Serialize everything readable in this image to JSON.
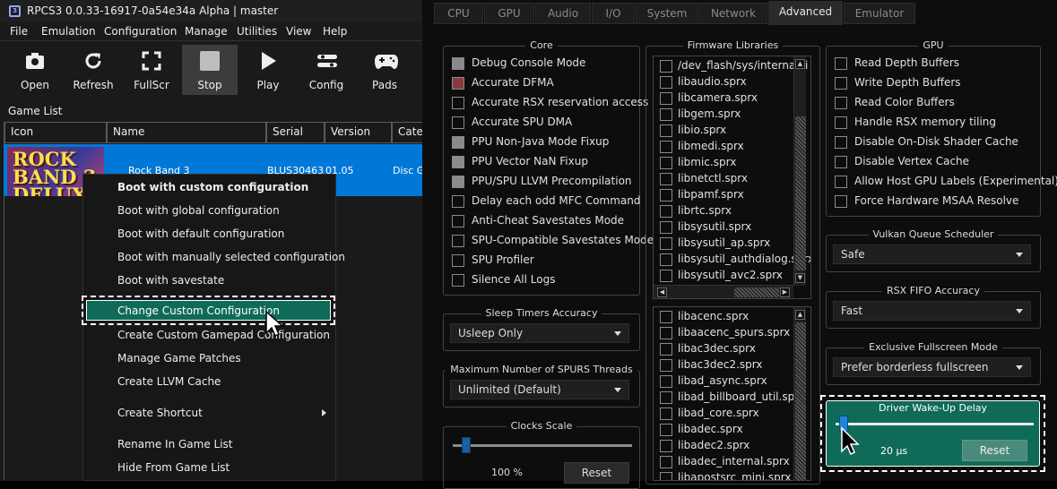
{
  "window": {
    "title": "RPCS3 0.0.33-16917-0a54e34a Alpha | master"
  },
  "menu": [
    "File",
    "Emulation",
    "Configuration",
    "Manage",
    "Utilities",
    "View",
    "Help"
  ],
  "toolbar": [
    {
      "label": "Open",
      "icon": "open-icon"
    },
    {
      "label": "Refresh",
      "icon": "refresh-icon"
    },
    {
      "label": "FullScr",
      "icon": "fullscreen-icon"
    },
    {
      "label": "Stop",
      "icon": "stop-icon",
      "active": true
    },
    {
      "label": "Play",
      "icon": "play-icon"
    },
    {
      "label": "Config",
      "icon": "config-icon"
    },
    {
      "label": "Pads",
      "icon": "gamepad-icon"
    }
  ],
  "game_list": {
    "label": "Game List",
    "columns": [
      "Icon",
      "Name",
      "Serial",
      "Version",
      "Categ"
    ],
    "rows": [
      {
        "icon_text": "ROCK BAND 3 DELUXE",
        "name": "Rock Band 3",
        "serial": "BLUS30463",
        "version": "01.05",
        "category": "Disc G"
      }
    ]
  },
  "context_menu": {
    "items": [
      "Boot with custom configuration",
      "Boot with global configuration",
      "Boot with default configuration",
      "Boot with manually selected configuration",
      "Boot with savestate",
      "Change Custom Configuration",
      "Create Custom Gamepad Configuration",
      "Manage Game Patches",
      "Create LLVM Cache",
      "Create Shortcut",
      "Rename In Game List",
      "Hide From Game List"
    ],
    "highlighted": "Change Custom Configuration"
  },
  "tabs": [
    "CPU",
    "GPU",
    "Audio",
    "I/O",
    "System",
    "Network",
    "Advanced",
    "Emulator"
  ],
  "selected_tab": "Advanced",
  "core": {
    "title": "Core",
    "options": [
      {
        "label": "Debug Console Mode",
        "state": "disabled"
      },
      {
        "label": "Accurate DFMA",
        "state": "checked-disabled"
      },
      {
        "label": "Accurate RSX reservation access",
        "state": "unchecked"
      },
      {
        "label": "Accurate SPU DMA",
        "state": "unchecked"
      },
      {
        "label": "PPU Non-Java Mode Fixup",
        "state": "disabled"
      },
      {
        "label": "PPU Vector NaN Fixup",
        "state": "disabled"
      },
      {
        "label": "PPU/SPU LLVM Precompilation",
        "state": "disabled"
      },
      {
        "label": "Delay each odd MFC Command",
        "state": "unchecked"
      },
      {
        "label": "Anti-Cheat Savestates Mode",
        "state": "unchecked"
      },
      {
        "label": "SPU-Compatible Savestates Mode",
        "state": "unchecked"
      },
      {
        "label": "SPU Profiler",
        "state": "unchecked"
      },
      {
        "label": "Silence All Logs",
        "state": "unchecked"
      }
    ]
  },
  "sleep_timers": {
    "title": "Sleep Timers Accuracy",
    "value": "Usleep Only"
  },
  "spurs": {
    "title": "Maximum Number of SPURS Threads",
    "value": "Unlimited (Default)"
  },
  "clocks": {
    "title": "Clocks Scale",
    "value_text": "100 %",
    "reset": "Reset",
    "level": 0.05
  },
  "firmware": {
    "title": "Firmware Libraries",
    "list1": [
      "/dev_flash/sys/internal/li",
      "libaudio.sprx",
      "libcamera.sprx",
      "libgem.sprx",
      "libio.sprx",
      "libmedi.sprx",
      "libmic.sprx",
      "libnetctl.sprx",
      "libpamf.sprx",
      "librtc.sprx",
      "libsysutil.sprx",
      "libsysutil_ap.sprx",
      "libsysutil_authdialog.sprx",
      "libsysutil_avc2.sprx"
    ],
    "list2": [
      "libacenc.sprx",
      "libaacenc_spurs.sprx",
      "libac3dec.sprx",
      "libac3dec2.sprx",
      "libad_async.sprx",
      "libad_billboard_util.sprx",
      "libad_core.sprx",
      "libadec.sprx",
      "libadec2.sprx",
      "libadec_internal.sprx",
      "libapostsrc_mini.sprx"
    ]
  },
  "gpu": {
    "title": "GPU",
    "options": [
      "Read Depth Buffers",
      "Write Depth Buffers",
      "Read Color Buffers",
      "Handle RSX memory tiling",
      "Disable On-Disk Shader Cache",
      "Disable Vertex Cache",
      "Allow Host GPU Labels (Experimental)",
      "Force Hardware MSAA Resolve"
    ]
  },
  "vulkan_queue": {
    "title": "Vulkan Queue Scheduler",
    "value": "Safe"
  },
  "rsx_fifo": {
    "title": "RSX FIFO Accuracy",
    "value": "Fast"
  },
  "fullscreen_mode": {
    "title": "Exclusive Fullscreen Mode",
    "value": "Prefer borderless fullscreen"
  },
  "driver_wakeup": {
    "title": "Driver Wake-Up Delay",
    "value_text": "20 µs",
    "reset": "Reset",
    "level": 0.02
  },
  "colors": {
    "accent": "#0f6b57",
    "selection": "#0078d7"
  }
}
